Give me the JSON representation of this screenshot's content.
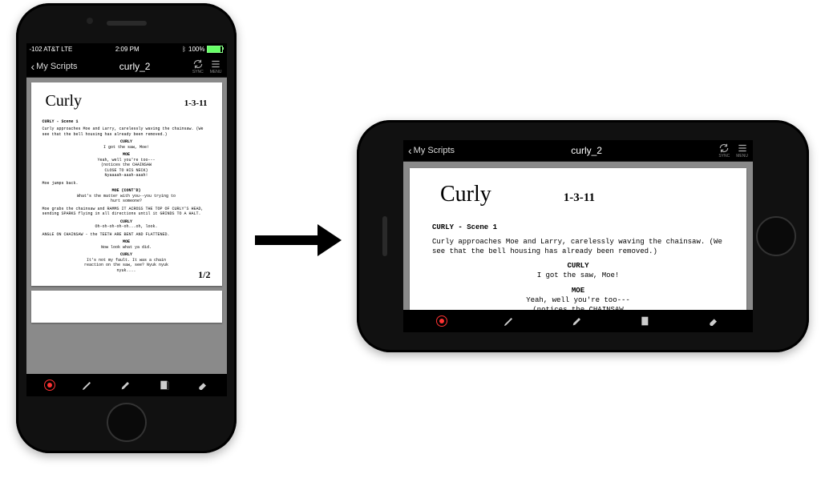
{
  "status": {
    "carrier": "-102 AT&T LTE",
    "time": "2:09 PM",
    "battery_pct": "100%"
  },
  "nav": {
    "back_label": "My Scripts",
    "title": "curly_2",
    "sync_label": "SYNC",
    "menu_label": "MENU"
  },
  "script": {
    "hand_title": "Curly",
    "hand_date": "1-3-11",
    "slug": "CURLY - Scene 1",
    "action1": "Curly approaches Moe and Larry, carelessly waving the chainsaw. (We see that the bell housing has already been removed.)",
    "c1": "CURLY",
    "d1": "I got the saw, Moe!",
    "c2": "MOE",
    "d2": "Yeah, well you're too---",
    "p2a": "(notices the CHAINSAW",
    "p2b": "CLOSE TO HIS NECK)",
    "d2b": "Nyaaaah-aaah-aaah!",
    "action2": "Moe jumps back.",
    "c3": "MOE (CONT'D)",
    "d3": "What's the matter with you--you trying to hurt someone?",
    "action3": "Moe grabs the chainsaw and RAMMS IT ACROSS THE TOP OF CURLY'S HEAD, sending SPARKS flying in all directions until it GRINDS TO A HALT.",
    "c4": "CURLY",
    "d4": "Oh-oh-oh-oh-oh...oh, look.",
    "action4": "ANGLE ON CHAINSAW - the TEETH ARE BENT AND FLATTENED.",
    "c5": "MOE",
    "d5": "Now look what ya did.",
    "c6": "CURLY",
    "d6": "It's not my fault. It was a chain reaction on the saw, see? Nyuk nyuk nyuk....",
    "page_number": "1/2"
  },
  "tools": {
    "record": "record",
    "pen": "pen",
    "highlighter": "highlighter",
    "note": "note",
    "eraser": "eraser"
  }
}
